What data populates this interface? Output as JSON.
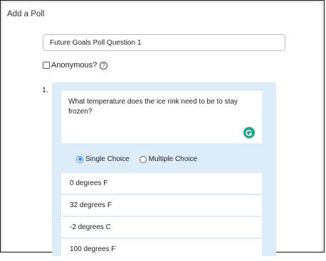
{
  "dialog": {
    "title": "Add a Poll"
  },
  "poll": {
    "topic_value": "Future Goals Poll Question 1",
    "anonymous_label": "Anonymous?",
    "anonymous_checked": false
  },
  "question": {
    "number": "1.",
    "text": "What temperature does the ice rink need to be to stay frozen?",
    "type_options": [
      {
        "label": "Single Choice",
        "selected": true
      },
      {
        "label": "Multiple Choice",
        "selected": false
      }
    ],
    "answers": [
      "0 degrees F",
      "32 degrees F",
      "-2 degrees C",
      "100 degrees F"
    ]
  },
  "colors": {
    "panel": "#dcedf9",
    "accent": "#2d8cff",
    "grammarly": "#17a789"
  },
  "icons": {
    "help": "help-circle-icon",
    "grammarly": "grammarly-icon"
  }
}
